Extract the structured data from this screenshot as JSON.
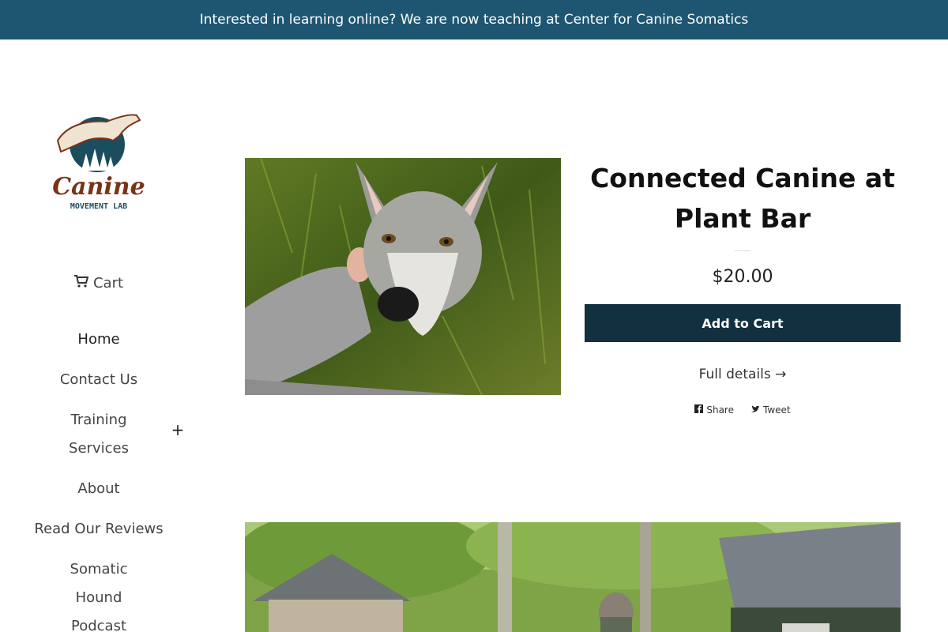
{
  "announcement": {
    "text": "Interested in learning online? We are now teaching at Center for Canine Somatics"
  },
  "logo": {
    "wordmark": "Canine",
    "tagline": "MOVEMENT LAB"
  },
  "sidebar": {
    "cart_label": "Cart",
    "nav": [
      {
        "label": "Home"
      },
      {
        "label": "Contact Us"
      },
      {
        "label": "Training Services",
        "expander": "+"
      },
      {
        "label": "About"
      },
      {
        "label": "Read Our Reviews"
      },
      {
        "label": "Somatic Hound Podcast"
      }
    ]
  },
  "product": {
    "title": "Connected Canine at Plant Bar",
    "price": "$20.00",
    "add_to_cart": "Add to Cart",
    "full_details": "Full details →",
    "share_label": "Share",
    "tweet_label": "Tweet"
  },
  "colors": {
    "announcement_bg": "#1e5672",
    "button_bg": "#12303f",
    "logo_brown": "#7a3318",
    "logo_teal": "#1c4d5e"
  },
  "icons": {
    "cart": "cart-icon",
    "facebook": "facebook-icon",
    "twitter": "twitter-icon",
    "expand": "plus-icon"
  }
}
